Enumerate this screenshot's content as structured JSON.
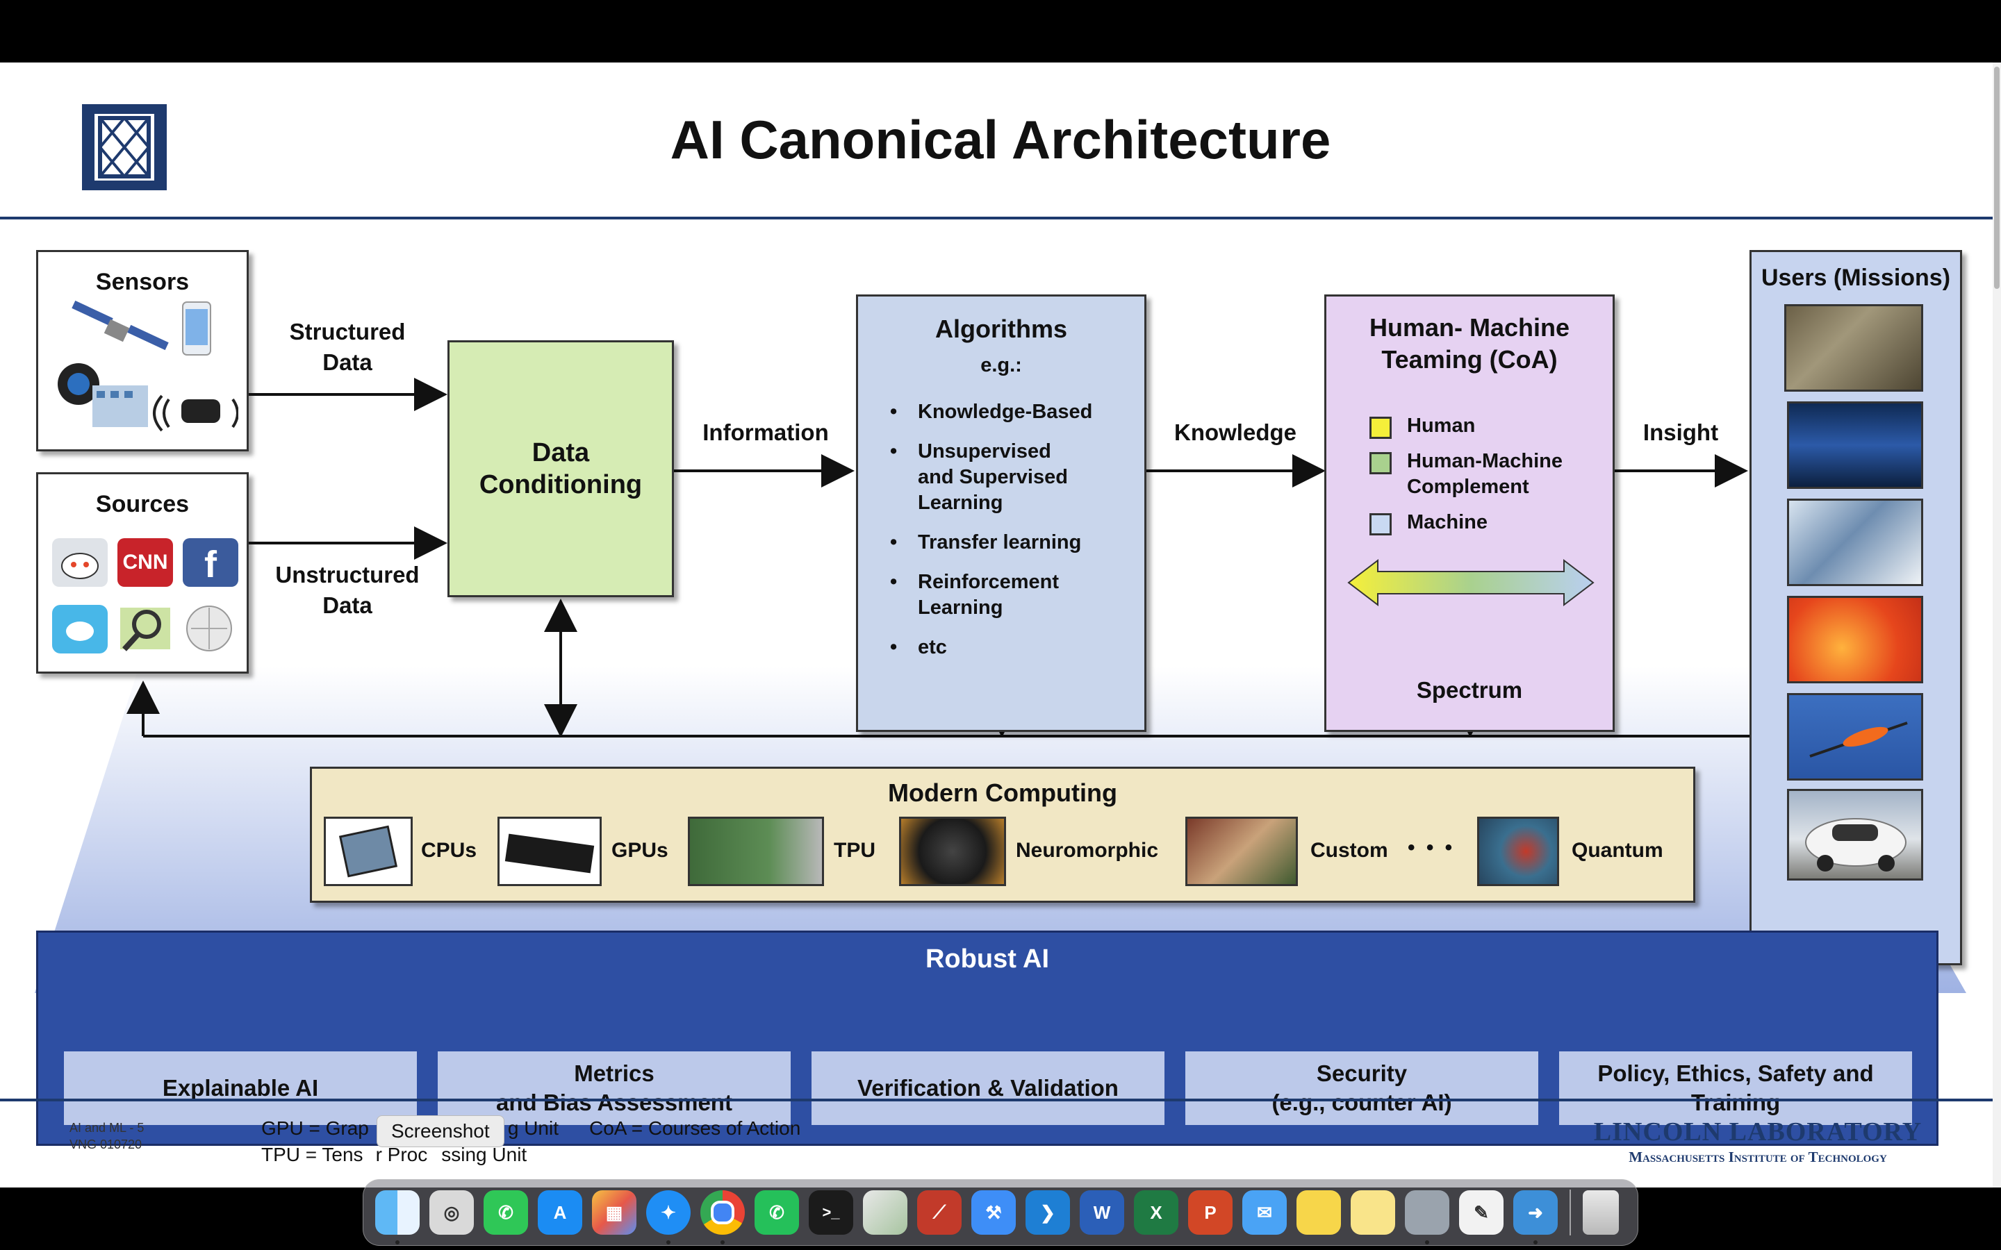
{
  "slide": {
    "title": "AI Canonical Architecture",
    "sensors": {
      "title": "Sensors"
    },
    "sources": {
      "title": "Sources"
    },
    "structured_label": "Structured\nData",
    "unstructured_label": "Unstructured\nData",
    "data_conditioning": "Data\nConditioning",
    "information_label": "Information",
    "algorithms": {
      "title": "Algorithms",
      "subtitle": "e.g.:",
      "items": [
        "Knowledge-Based",
        "Unsupervised\nand Supervised\nLearning",
        "Transfer learning",
        "Reinforcement\nLearning",
        "etc"
      ]
    },
    "knowledge_label": "Knowledge",
    "hmt": {
      "title": "Human- Machine\nTeaming (CoA)",
      "legend": [
        {
          "label": "Human",
          "color": "#f5ef3a"
        },
        {
          "label": "Human-Machine\nComplement",
          "color": "#a9d18e"
        },
        {
          "label": "Machine",
          "color": "#c9d9f2"
        }
      ],
      "spectrum": "Spectrum"
    },
    "insight_label": "Insight",
    "users": {
      "title": "Users (Missions)"
    },
    "modern_computing": {
      "title": "Modern Computing",
      "items": [
        "CPUs",
        "GPUs",
        "TPU",
        "Neuromorphic",
        "Custom",
        "• • •",
        "Quantum"
      ]
    },
    "robust": {
      "title": "Robust AI",
      "items": [
        "Explainable AI",
        "Metrics\nand Bias Assessment",
        "Verification & Validation",
        "Security\n(e.g., counter AI)",
        "Policy, Ethics, Safety and\nTraining"
      ]
    },
    "footer": {
      "slide_id_1": "AI and ML - 5",
      "slide_id_2": "VNG  010720",
      "gpu_line_a": "GPU = Grap",
      "gpu_line_b": "g Unit",
      "coa": "CoA = Courses of Action",
      "tpu_line_a": "TPU = Tens",
      "tpu_line_b": "r Proc",
      "tpu_line_c": "ssing Unit",
      "org_1": "LINCOLN LABORATORY",
      "org_2": "Massachusetts Institute of Technology"
    },
    "tooltip": "Screenshot"
  },
  "colors": {
    "data_conditioning": "#d6ecb4",
    "algorithms": "#c9d6ec",
    "hmt": "#e6d2f2",
    "modern_computing": "#f1e7c4",
    "robust_bg": "#2e4fa3",
    "robust_item": "#bcc9ea"
  },
  "dock": {
    "apps": [
      "finder-icon",
      "screenshot-icon",
      "whatsapp-icon",
      "app-store-icon",
      "launchpad-icon",
      "safari-icon",
      "chrome-icon",
      "whatsapp-alt-icon",
      "terminal-icon",
      "preview-icon",
      "testflight-icon",
      "xcode-icon",
      "vscode-icon",
      "word-icon",
      "excel-icon",
      "powerpoint-icon",
      "mail-icon",
      "notes-icon",
      "stickies-icon",
      "disk-utility-icon",
      "textedit-icon",
      "migration-icon",
      "trash-icon"
    ],
    "labels": {
      "word": "W",
      "excel": "X",
      "powerpoint": "P",
      "terminal": ">_",
      "vscode": "❯"
    }
  }
}
